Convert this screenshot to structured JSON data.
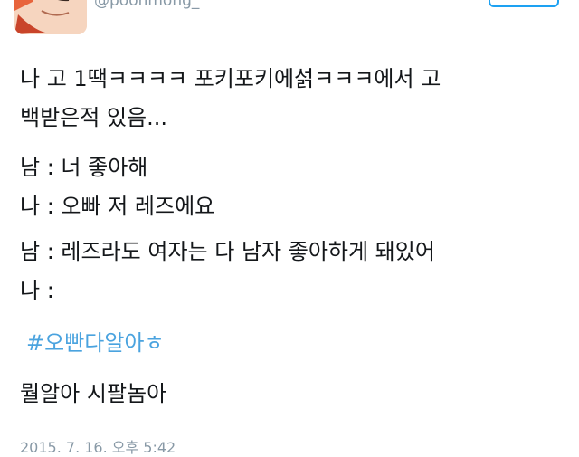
{
  "tweet": {
    "handle": "@poonmong_",
    "lines": [
      "나 고 1땍ㅋㅋㅋㅋ 포키포키에섥ㅋㅋㅋ에서 고",
      "백받은적 있음...",
      "남 : 너 좋아해",
      "나 : 오빠 저 레즈에요",
      "남 : 레즈라도 여자는 다 남자 좋아하게 돼있어",
      "나 :"
    ],
    "hashtag": "#오빤다알아ㅎ",
    "reply": "뭘알아 시팔놈아",
    "timestamp": "2015. 7. 16. 오후 5:42"
  },
  "colors": {
    "text": "#14171a",
    "hashtag": "#4aa3df",
    "muted": "#8899a6",
    "accent": "#1da1f2"
  }
}
